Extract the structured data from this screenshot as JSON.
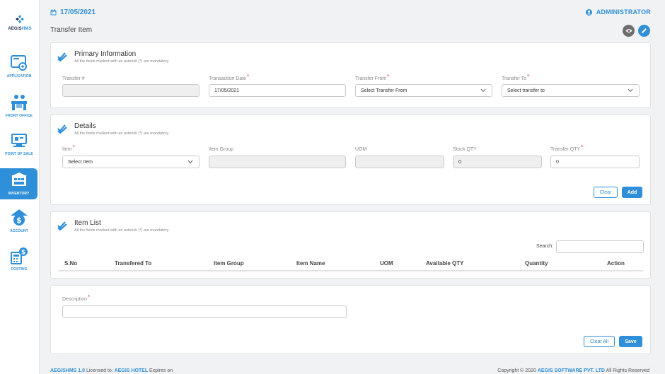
{
  "brand": {
    "name_a": "AEGIS",
    "name_b": "HMS"
  },
  "sidebar": {
    "items": [
      {
        "label": "APPLICATION",
        "icon": "application-icon"
      },
      {
        "label": "FRONT OFFICE",
        "icon": "front-office-icon"
      },
      {
        "label": "POINT OF SALE",
        "icon": "point-of-sale-icon"
      },
      {
        "label": "INVENTORY",
        "icon": "inventory-icon",
        "active": true
      },
      {
        "label": "ACCOUNT",
        "icon": "account-icon"
      },
      {
        "label": "COSTING",
        "icon": "costing-icon"
      }
    ]
  },
  "header": {
    "date": "17/05/2021",
    "user": "ADMINISTRATOR",
    "page_title": "Transfer Item"
  },
  "primary": {
    "title": "Primary Information",
    "note": "All the fields marked with an asterisk (*) are mandatory.",
    "transfer_no_label": "Transfer #",
    "transfer_no_value": "",
    "transaction_date_label": "Transaction Date",
    "transaction_date_value": "17/05/2021",
    "transfer_from_label": "Transfer From",
    "transfer_from_value": "Select Transfer From",
    "transfer_to_label": "Transfer To",
    "transfer_to_value": "Select transfer to"
  },
  "details": {
    "title": "Details",
    "note": "All the fields marked with an asterisk (*) are mandatory.",
    "item_label": "Item",
    "item_value": "Select Item",
    "item_group_label": "Item Group",
    "item_group_value": "",
    "uom_label": "UOM",
    "uom_value": "",
    "stock_qty_label": "Stock QTY",
    "stock_qty_value": "0",
    "transfer_qty_label": "Transfer QTY",
    "transfer_qty_value": "0",
    "clear_label": "Clear",
    "add_label": "Add"
  },
  "item_list": {
    "title": "Item List",
    "note": "All the fields marked with an asterisk (*) are mandatory.",
    "search_label": "Search:",
    "search_value": "",
    "columns": [
      "S.No",
      "Transfered To",
      "Item Group",
      "Item Name",
      "UOM",
      "Available QTY",
      "Quantity",
      "Action"
    ]
  },
  "description": {
    "label": "Description",
    "value": "",
    "clear_all_label": "Clear All",
    "save_label": "Save"
  },
  "footer": {
    "left_a": "AEGISHMS 1.0",
    "left_b": " Licensed to: ",
    "left_c": "AEGIS HOTEL",
    "left_d": "  Expires on",
    "right_a": "Copyright © 2020 ",
    "right_b": "AEGIS SOFTWARE PVT. LTD",
    "right_c": " All Rights Reserved"
  },
  "colors": {
    "accent": "#2f8fd8",
    "required": "#e53935",
    "background": "#f1f2f3"
  }
}
